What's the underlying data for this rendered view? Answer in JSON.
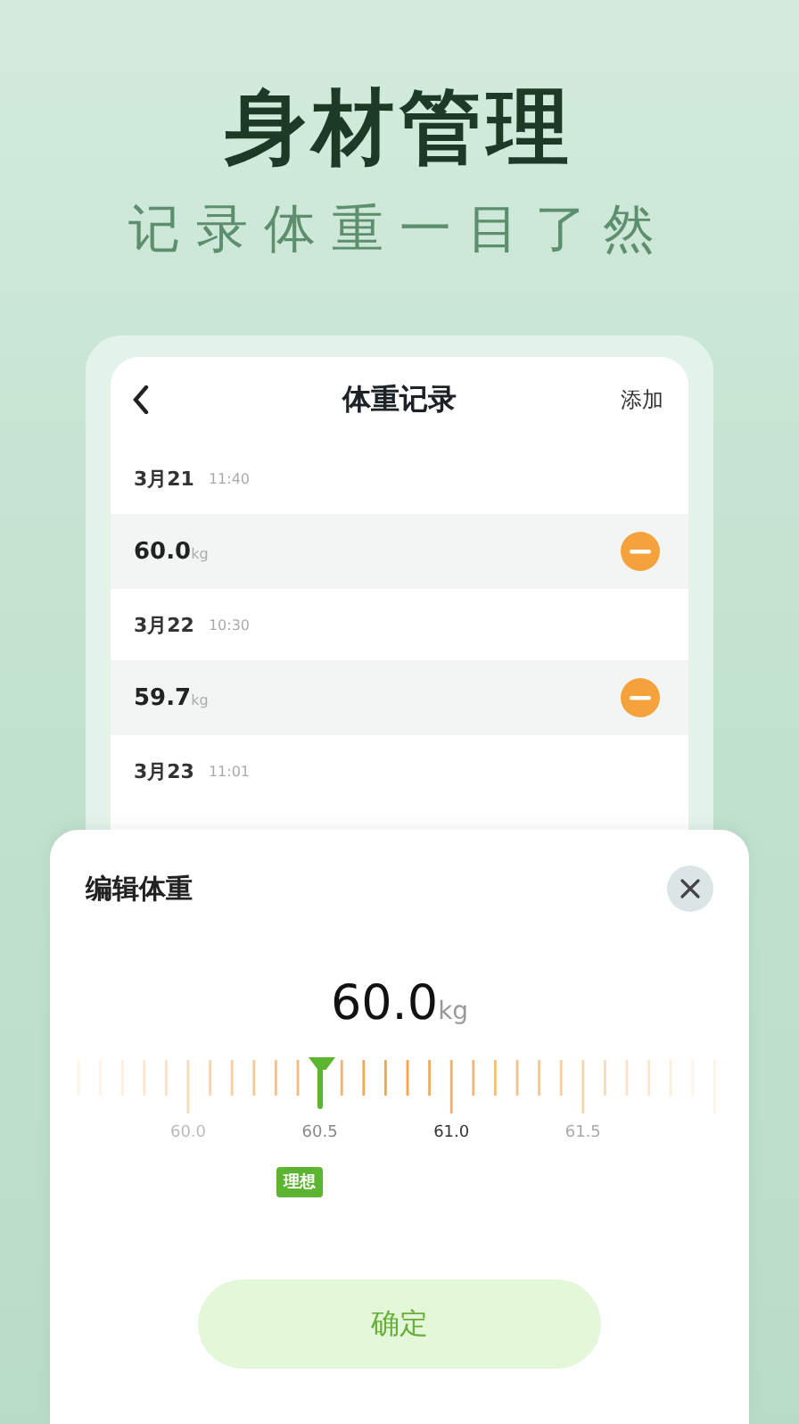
{
  "poster": {
    "title": "身材管理",
    "subtitle": "记录体重一目了然"
  },
  "screen": {
    "title": "体重记录",
    "action": "添加"
  },
  "records": [
    {
      "date": "3月21",
      "time": "11:40",
      "value": "60.0",
      "unit": "kg"
    },
    {
      "date": "3月22",
      "time": "10:30",
      "value": "59.7",
      "unit": "kg"
    },
    {
      "date": "3月23",
      "time": "11:01"
    }
  ],
  "sheet": {
    "title": "编辑体重",
    "value": "60.0",
    "unit": "kg",
    "scale_labels": [
      "60.0",
      "60.5",
      "61.0",
      "61.5"
    ],
    "tag": "理想",
    "confirm": "确定"
  }
}
